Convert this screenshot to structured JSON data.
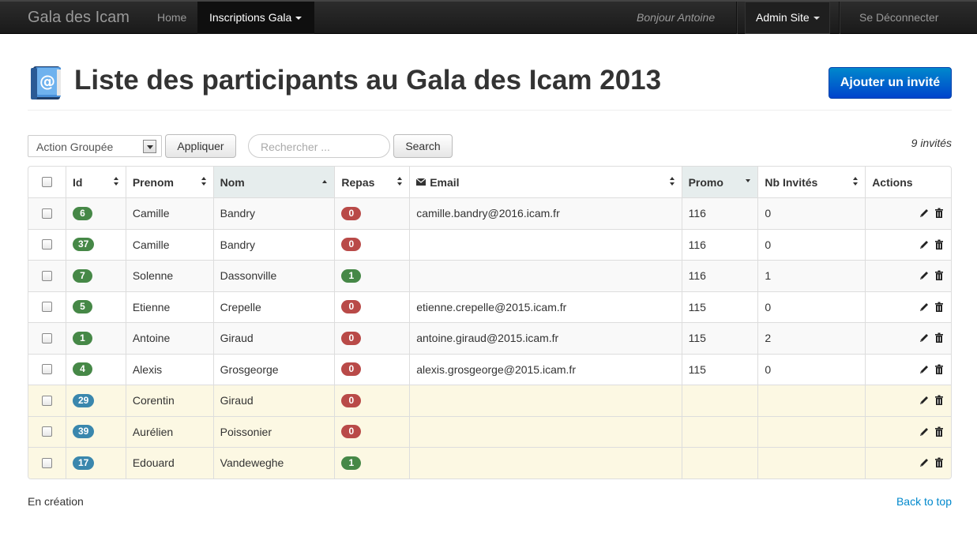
{
  "navbar": {
    "brand": "Gala des Icam",
    "home": "Home",
    "inscriptions": "Inscriptions Gala",
    "greeting": "Bonjour Antoine",
    "admin": "Admin Site",
    "logout": "Se Déconnecter"
  },
  "header": {
    "icon": "address-book-icon",
    "title": "Liste des participants au Gala des Icam 2013",
    "add_button": "Ajouter un invité"
  },
  "toolbar": {
    "bulk_action": "Action Groupée",
    "apply": "Appliquer",
    "search_placeholder": "Rechercher ...",
    "search_button": "Search",
    "count": "9 invités"
  },
  "table": {
    "columns": [
      "Id",
      "Prenom",
      "Nom",
      "Repas",
      "Email",
      "Promo",
      "Nb Invités",
      "Actions"
    ],
    "rows": [
      {
        "id": "6",
        "id_color": "green",
        "prenom": "Camille",
        "nom": "Bandry",
        "repas": "0",
        "email": "camille.bandry@2016.icam.fr",
        "promo": "116",
        "invites": "0",
        "style": "odd"
      },
      {
        "id": "37",
        "id_color": "green",
        "prenom": "Camille",
        "nom": "Bandry",
        "repas": "0",
        "email": "",
        "promo": "116",
        "invites": "0",
        "style": "even"
      },
      {
        "id": "7",
        "id_color": "green",
        "prenom": "Solenne",
        "nom": "Dassonville",
        "repas": "1",
        "email": "",
        "promo": "116",
        "invites": "1",
        "style": "odd"
      },
      {
        "id": "5",
        "id_color": "green",
        "prenom": "Etienne",
        "nom": "Crepelle",
        "repas": "0",
        "email": "etienne.crepelle@2015.icam.fr",
        "promo": "115",
        "invites": "0",
        "style": "even"
      },
      {
        "id": "1",
        "id_color": "green",
        "prenom": "Antoine",
        "nom": "Giraud",
        "repas": "0",
        "email": "antoine.giraud@2015.icam.fr",
        "promo": "115",
        "invites": "2",
        "style": "odd"
      },
      {
        "id": "4",
        "id_color": "green",
        "prenom": "Alexis",
        "nom": "Grosgeorge",
        "repas": "0",
        "email": "alexis.grosgeorge@2015.icam.fr",
        "promo": "115",
        "invites": "0",
        "style": "even"
      },
      {
        "id": "29",
        "id_color": "blue",
        "prenom": "Corentin",
        "nom": "Giraud",
        "repas": "0",
        "email": "",
        "promo": "",
        "invites": "",
        "style": "warn"
      },
      {
        "id": "39",
        "id_color": "blue",
        "prenom": "Aurélien",
        "nom": "Poissonier",
        "repas": "0",
        "email": "",
        "promo": "",
        "invites": "",
        "style": "warn"
      },
      {
        "id": "17",
        "id_color": "blue",
        "prenom": "Edouard",
        "nom": "Vandeweghe",
        "repas": "1",
        "email": "",
        "promo": "",
        "invites": "",
        "style": "warn"
      }
    ]
  },
  "colors": {
    "green": "#468847",
    "red": "#b94a48",
    "blue": "#3a87ad",
    "primary": "#0088cc"
  },
  "footer": {
    "status": "En création",
    "back_to_top": "Back to top"
  }
}
